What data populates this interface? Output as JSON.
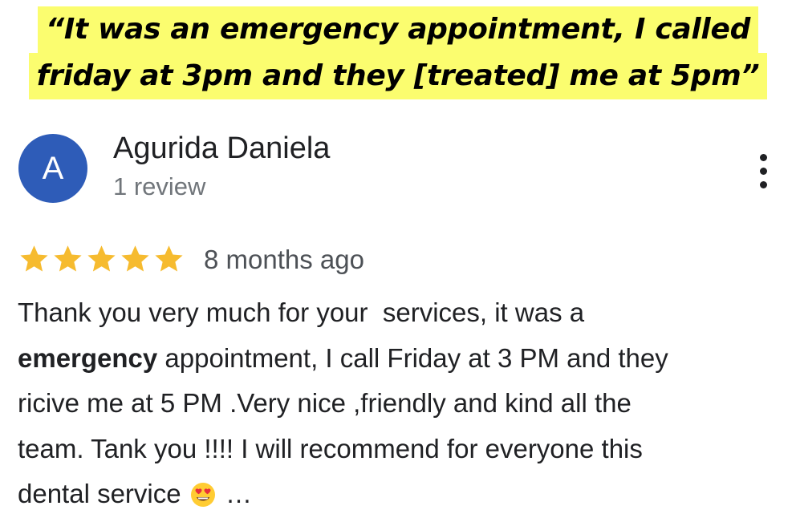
{
  "headline": {
    "line1": "“It was an emergency appointment, I called",
    "line2": "friday at 3pm and they [treated] me at 5pm”",
    "highlight_color": "#fbfd6f"
  },
  "reviewer": {
    "avatar_letter": "A",
    "avatar_color": "#2e5cb8",
    "name": "Agurida Daniela",
    "review_count": "1 review",
    "more_icon": "more-vert-icon"
  },
  "review": {
    "rating": 5,
    "rating_max": 5,
    "star_color": "#f6bb2f",
    "date": "8 months ago",
    "lines": {
      "l1": "Thank you very much for your  services, it was a",
      "l2_bold": "emergency",
      "l2_rest": " appointment, I call Friday at 3 PM and they",
      "l3": "ricive me at 5 PM .Very nice ,friendly and kind all the",
      "l4": "team. Tank you !!!! I will recommend for everyone this",
      "l5": "dental service"
    },
    "emoji": "heart-eyes-emoji",
    "more_text": "…"
  }
}
